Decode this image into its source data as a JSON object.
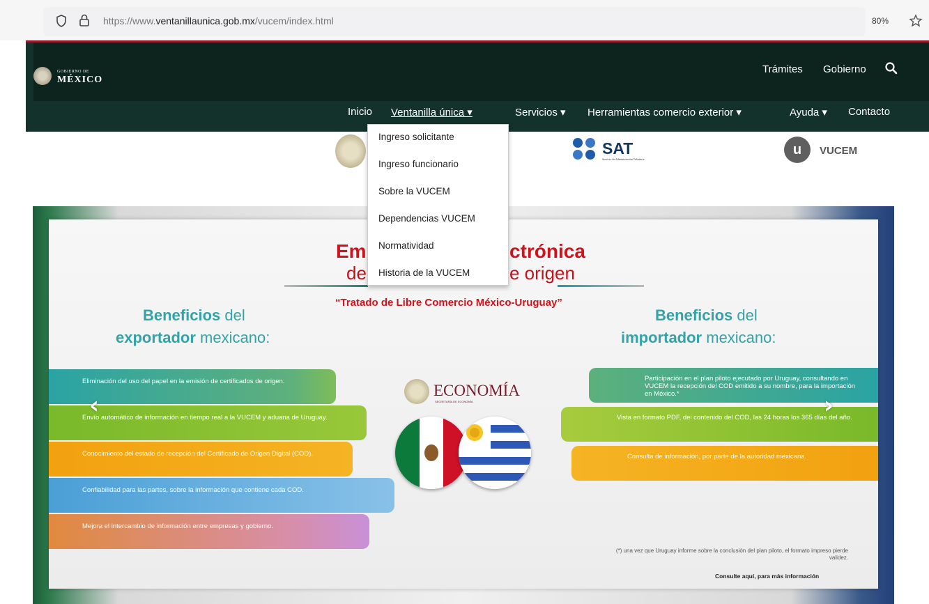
{
  "browser": {
    "url_prefix": "https://www.",
    "url_domain": "ventanillaunica.gob.mx",
    "url_path": "/vucem/index.html",
    "zoom": "80%"
  },
  "header": {
    "gov_small": "GOBIERNO DE",
    "gov_big": "MÉXICO",
    "top_links": [
      "Trámites",
      "Gobierno"
    ]
  },
  "nav": {
    "items": [
      "Inicio",
      "Ventanilla única ▾",
      "Servicios ▾",
      "Herramientas comercio exterior ▾",
      "Ayuda ▾",
      "Contacto"
    ]
  },
  "dropdown": {
    "items": [
      "Ingreso solicitante",
      "Ingreso funcionario",
      "Sobre la VUCEM",
      "Dependencias VUCEM",
      "Normatividad",
      "Historia de la VUCEM"
    ]
  },
  "logos": {
    "sat": "SAT",
    "sat_sub": "Servicio de Administración Tributaria",
    "vucem_letter": "u",
    "vucem": "VUCEM"
  },
  "banner": {
    "title_left": "Em",
    "title_right": "ctrónica",
    "subtitle_left": "de",
    "subtitle_right": "e origen",
    "tratado": "“Tratado de Libre Comercio México-Uruguay”",
    "left_heading_a": "Beneficios",
    "left_heading_b": " del",
    "left_heading_c": "exportador",
    "left_heading_d": " mexicano:",
    "right_heading_a": "Beneficios",
    "right_heading_b": " del",
    "right_heading_c": "importador",
    "right_heading_d": " mexicano:",
    "left_items": [
      "Eliminación del uso del papel en la emisión de certificados de origen.",
      "Envío automático de información en tiempo real a la VUCEM y aduana de Uruguay.",
      "Conocimiento del estado de recepción del Certificado de Origen Digital (COD).",
      "Confiabilidad para las partes, sobre la información que contiene cada COD.",
      "Mejora el intercambio de información entre empresas y gobierno."
    ],
    "right_items": [
      "Participación en el plan piloto ejecutado por Uruguay, consultando en VUCEM la recepción del COD emitido a su nombre, para la importación en México.*",
      "Vista en formato PDF, del contenido del COD, las 24 horas los 365 días del año.",
      "Consulta de información, por parte de la autoridad mexicana."
    ],
    "economia": "ECONOMÍA",
    "economia_sub": "SECRETARÍA DE ECONOMÍA",
    "footnote": "(*) una vez que Uruguay informe sobre la conclusión del plan piloto, el formato impreso pierde validez.",
    "consult": "Consulte aquí, para más información",
    "arrow_left": "‹",
    "arrow_right": "›"
  },
  "colors": {
    "gov_green": "#13322b",
    "accent_red": "#9b1b30",
    "title_red": "#d0121c",
    "teal": "#33a3a6"
  }
}
